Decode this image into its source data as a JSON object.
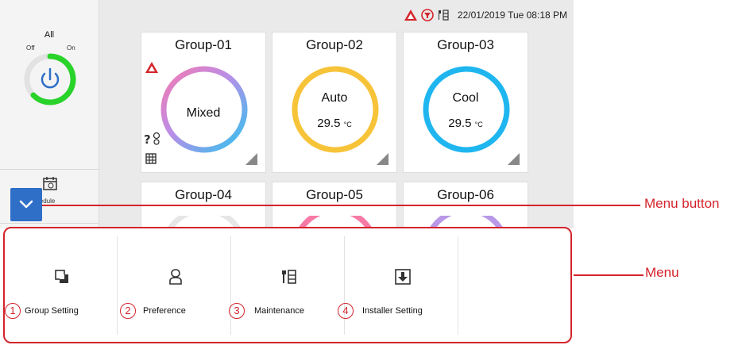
{
  "sidebar": {
    "all_label": "All",
    "off_label": "Off",
    "on_label": "On",
    "schedule_label": "Schedule"
  },
  "status": {
    "datetime": "22/01/2019 Tue 08:18 PM",
    "icons": [
      "warning-icon",
      "filter-icon",
      "maintenance-icon"
    ]
  },
  "groups": [
    {
      "name": "Group-01",
      "mode": "Mixed",
      "temp": "",
      "ring": "mixed"
    },
    {
      "name": "Group-02",
      "mode": "Auto",
      "temp": "29.5",
      "unit": "°C",
      "ring_color": "#f7c339"
    },
    {
      "name": "Group-03",
      "mode": "Cool",
      "temp": "29.5",
      "unit": "°C",
      "ring_color": "#1fb6f0"
    },
    {
      "name": "Group-04"
    },
    {
      "name": "Group-05"
    },
    {
      "name": "Group-06"
    }
  ],
  "menu": {
    "items": [
      {
        "num": "1",
        "label": "Group Setting",
        "icon": "group-setting-icon"
      },
      {
        "num": "2",
        "label": "Preference",
        "icon": "person-icon"
      },
      {
        "num": "3",
        "label": "Maintenance",
        "icon": "maintenance-icon"
      },
      {
        "num": "4",
        "label": "Installer Setting",
        "icon": "download-icon"
      }
    ]
  },
  "annotations": {
    "menu_button": "Menu button",
    "menu": "Menu"
  },
  "colors": {
    "accent_red": "#d4242b",
    "menu_button_blue": "#2f6fc8",
    "power_green": "#29d32a"
  }
}
